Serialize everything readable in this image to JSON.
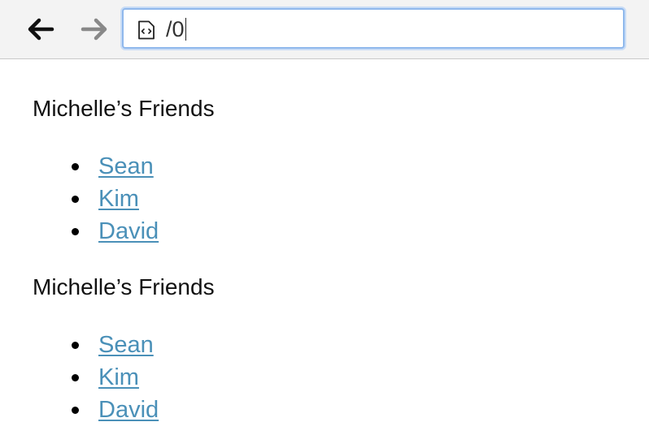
{
  "toolbar": {
    "back_icon": "arrow-left-icon",
    "forward_icon": "arrow-right-icon",
    "address": {
      "page_icon": "source-file-icon",
      "url": "/0"
    },
    "colors": {
      "focus_ring": "#8fb8ec",
      "back_arrow": "#111111",
      "forward_arrow": "#888888"
    }
  },
  "sections": [
    {
      "title": "Michelle’s Friends",
      "friends": [
        "Sean",
        "Kim",
        "David"
      ]
    },
    {
      "title": "Michelle’s Friends",
      "friends": [
        "Sean",
        "Kim",
        "David"
      ]
    }
  ],
  "colors": {
    "link": "#4a90b8",
    "text": "#111111"
  }
}
